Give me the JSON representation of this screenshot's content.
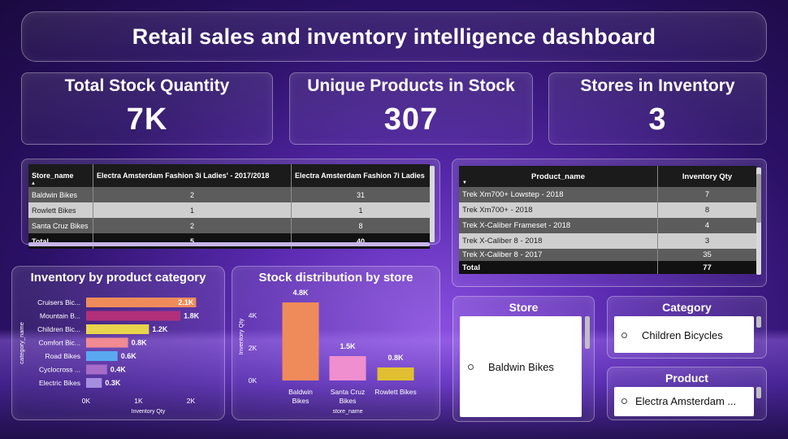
{
  "header": {
    "title": "Retail sales and inventory intelligence dashboard"
  },
  "kpis": [
    {
      "label": "Total Stock Quantity",
      "value": "7K"
    },
    {
      "label": "Unique Products in Stock",
      "value": "307"
    },
    {
      "label": "Stores in Inventory",
      "value": "3"
    }
  ],
  "store_matrix": {
    "columns": [
      "Store_name",
      "Electra Amsterdam Fashion 3i Ladies' - 2017/2018",
      "Electra Amsterdam Fashion 7i Ladies"
    ],
    "rows": [
      [
        "Baldwin Bikes",
        "2",
        "31"
      ],
      [
        "Rowlett Bikes",
        "1",
        "1"
      ],
      [
        "Santa Cruz Bikes",
        "2",
        "8"
      ]
    ],
    "total": [
      "Total",
      "5",
      "40"
    ]
  },
  "product_table": {
    "columns": [
      "Product_name",
      "Inventory Qty"
    ],
    "rows": [
      [
        "Trek Xm700+ Lowstep - 2018",
        "7"
      ],
      [
        "Trek Xm700+ - 2018",
        "8"
      ],
      [
        "Trek X-Caliber Frameset - 2018",
        "4"
      ],
      [
        "Trek X-Caliber 8 - 2018",
        "3"
      ],
      [
        "Trek X-Caliber 8 - 2017",
        "35"
      ]
    ],
    "total": [
      "Total",
      "77"
    ]
  },
  "chart_data": [
    {
      "type": "bar",
      "orientation": "horizontal",
      "title": "Inventory by product category",
      "xlabel": "Inventory Qty",
      "ylabel": "category_name",
      "categories": [
        "Cruisers Bic...",
        "Mountain B...",
        "Children Bic...",
        "Comfort Bic...",
        "Road Bikes",
        "Cyclocross ...",
        "Electric Bikes"
      ],
      "values": [
        2100,
        1800,
        1200,
        800,
        600,
        400,
        300
      ],
      "data_labels": [
        "2.1K",
        "1.8K",
        "1.2K",
        "0.8K",
        "0.6K",
        "0.4K",
        "0.3K"
      ],
      "colors": [
        "#ef8b5a",
        "#b0307a",
        "#e8d44d",
        "#f08a93",
        "#5aa9f0",
        "#a56cc8",
        "#a58de0"
      ],
      "xticks": [
        "0K",
        "1K",
        "2K"
      ],
      "xlim": [
        0,
        2000
      ]
    },
    {
      "type": "bar",
      "title": "Stock distribution by store",
      "xlabel": "store_name",
      "ylabel": "Inventory Qty",
      "categories": [
        "Baldwin Bikes",
        "Santa Cruz Bikes",
        "Rowlett Bikes"
      ],
      "values": [
        4800,
        1500,
        800
      ],
      "data_labels": [
        "4.8K",
        "1.5K",
        "0.8K"
      ],
      "colors": [
        "#ef8b5a",
        "#ef8fcf",
        "#e0c030"
      ],
      "yticks": [
        "0K",
        "2K",
        "4K"
      ],
      "ylim": [
        0,
        5000
      ]
    }
  ],
  "slicers": {
    "store": {
      "title": "Store",
      "selected": "Baldwin Bikes"
    },
    "category": {
      "title": "Category",
      "selected": "Children Bicycles"
    },
    "product": {
      "title": "Product",
      "selected": "Electra Amsterdam ..."
    }
  }
}
